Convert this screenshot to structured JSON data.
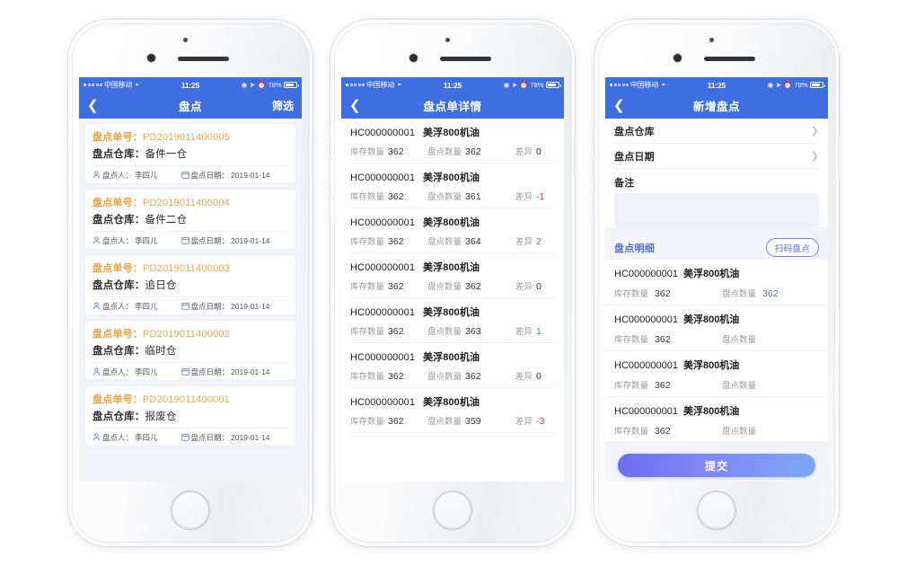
{
  "status_bar": {
    "carrier": "中国移动",
    "wifi_icon": "wifi-icon",
    "time": "11:25",
    "battery_percent": "78%",
    "location_icon": "location-arrow-icon",
    "alarm_icon": "alarm-icon",
    "rotation_lock_icon": "rotation-lock-icon"
  },
  "phone1": {
    "nav": {
      "back_icon": "chevron-left-icon",
      "title": "盘点",
      "action_label": "筛选"
    },
    "labels": {
      "order_no": "盘点单号：",
      "warehouse": "盘点仓库：",
      "person": "盘点人：",
      "date": "盘点日期："
    },
    "cards": [
      {
        "order_no": "PD2019011400005",
        "warehouse": "备件一仓",
        "person": "李四儿",
        "date": "2019-01-14"
      },
      {
        "order_no": "PD2019011400004",
        "warehouse": "备件二仓",
        "person": "李四儿",
        "date": "2019-01-14"
      },
      {
        "order_no": "PD2019011400003",
        "warehouse": "追日仓",
        "person": "李四儿",
        "date": "2019-01-14"
      },
      {
        "order_no": "PD2019011400002",
        "warehouse": "临时仓",
        "person": "李四儿",
        "date": "2019-01-14"
      },
      {
        "order_no": "PD2019011400001",
        "warehouse": "报废仓",
        "person": "李四儿",
        "date": "2019-01-14"
      }
    ]
  },
  "phone2": {
    "nav": {
      "back_icon": "chevron-left-icon",
      "title": "盘点单详情"
    },
    "labels": {
      "stock_qty": "库存数量",
      "count_qty": "盘点数量",
      "diff": "差异"
    },
    "items": [
      {
        "code": "HC000000001",
        "name": "美浮800机油",
        "stock": "362",
        "count": "362",
        "diff": "0",
        "diff_sign": "zero"
      },
      {
        "code": "HC000000001",
        "name": "美浮800机油",
        "stock": "362",
        "count": "361",
        "diff": "-1",
        "diff_sign": "neg"
      },
      {
        "code": "HC000000001",
        "name": "美浮800机油",
        "stock": "362",
        "count": "364",
        "diff": "2",
        "diff_sign": "pos"
      },
      {
        "code": "HC000000001",
        "name": "美浮800机油",
        "stock": "362",
        "count": "362",
        "diff": "0",
        "diff_sign": "zero"
      },
      {
        "code": "HC000000001",
        "name": "美浮800机油",
        "stock": "362",
        "count": "363",
        "diff": "1",
        "diff_sign": "pos"
      },
      {
        "code": "HC000000001",
        "name": "美浮800机油",
        "stock": "362",
        "count": "362",
        "diff": "0",
        "diff_sign": "zero"
      },
      {
        "code": "HC000000001",
        "name": "美浮800机油",
        "stock": "362",
        "count": "359",
        "diff": "-3",
        "diff_sign": "neg"
      }
    ]
  },
  "phone3": {
    "nav": {
      "back_icon": "chevron-left-icon",
      "title": "新增盘点"
    },
    "form": {
      "warehouse_label": "盘点仓库",
      "date_label": "盘点日期",
      "note_label": "备注",
      "note_value": "",
      "chevron_icon": "chevron-right-icon"
    },
    "detail_section": {
      "title": "盘点明细",
      "scan_label": "扫码盘点",
      "stock_label": "库存数量",
      "count_label": "盘点数量"
    },
    "items": [
      {
        "code": "HC000000001",
        "name": "美浮800机油",
        "stock": "362",
        "count": "362"
      },
      {
        "code": "HC000000001",
        "name": "美浮800机油",
        "stock": "362",
        "count": ""
      },
      {
        "code": "HC000000001",
        "name": "美浮800机油",
        "stock": "362",
        "count": ""
      },
      {
        "code": "HC000000001",
        "name": "美浮800机油",
        "stock": "362",
        "count": ""
      }
    ],
    "submit_label": "提交"
  },
  "colors": {
    "brand_blue": "#3f6ee0",
    "accent_orange": "#f2a64a",
    "diff_positive": "#3ea93e",
    "diff_negative": "#e33b3b",
    "link_blue": "#4e6fdb",
    "screen_bg": "#f2f4f9"
  }
}
